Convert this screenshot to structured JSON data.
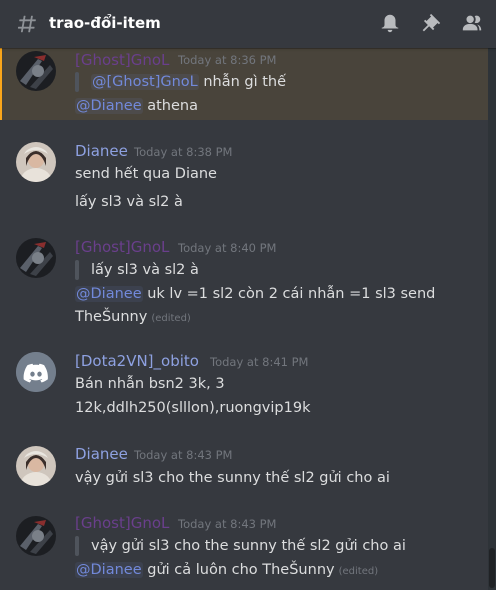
{
  "header": {
    "channel_name": "trao-đổi-item"
  },
  "messages": [
    {
      "username": "[Ghost]GnoL",
      "timestamp": "Today at 8:36 PM",
      "quote_mention": "@[Ghost]GnoL",
      "quote_text": " nhẫn gì thế",
      "reply_mention": "@Dianee",
      "reply_text": " athena"
    },
    {
      "username": "Dianee",
      "timestamp": "Today at 8:38 PM",
      "lines": [
        "send hết qua Diane",
        "lấy sl3 và sl2 à"
      ]
    },
    {
      "username": "[Ghost]GnoL",
      "timestamp": "Today at 8:40 PM",
      "quote_text": "lấy sl3 và sl2 à",
      "reply_mention": "@Dianee",
      "reply_text": " uk lv =1 sl2 còn 2 cái nhẫn =1 sl3 send",
      "reply_line2": "TheŠunny",
      "edited": "(edited)"
    },
    {
      "username": "[Dota2VN]_obito",
      "timestamp": "Today at 8:41 PM",
      "lines": [
        "Bán nhẫn bsn2 3k, 3",
        "12k,ddlh250(slllon),ruongvip19k"
      ]
    },
    {
      "username": "Dianee",
      "timestamp": "Today at 8:43 PM",
      "lines": [
        "vậy gửi sl3 cho the sunny thế sl2 gửi cho ai"
      ]
    },
    {
      "username": "[Ghost]GnoL",
      "timestamp": "Today at 8:43 PM",
      "quote_text": "vậy gửi sl3 cho the sunny thế sl2 gửi cho ai",
      "reply_mention": "@Dianee",
      "reply_text": " gửi cả luôn cho TheŠunny",
      "edited": "(edited)"
    }
  ]
}
